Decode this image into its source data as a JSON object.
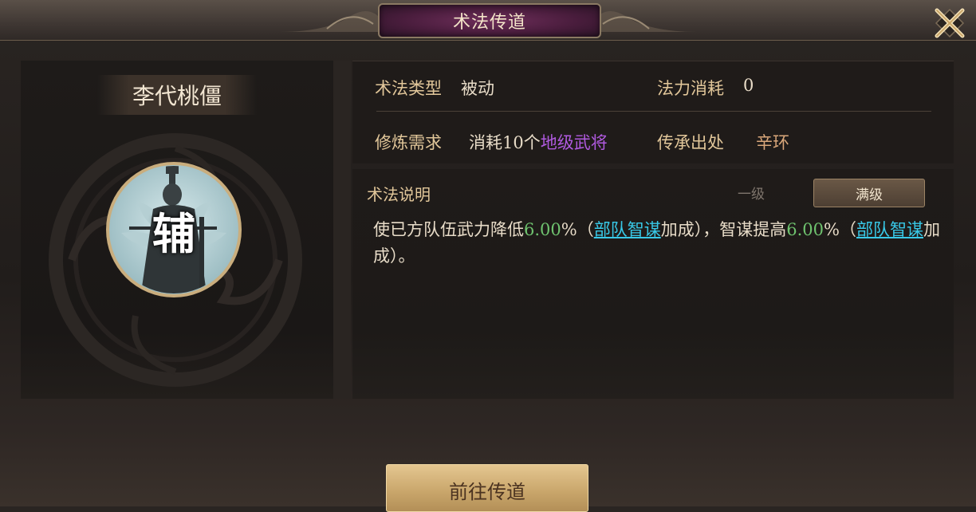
{
  "header": {
    "title": "术法传道"
  },
  "hero": {
    "name": "李代桃僵",
    "role_char": "辅"
  },
  "info": {
    "type_label": "术法类型",
    "type_value": "被动",
    "mana_label": "法力消耗",
    "mana_value": "0",
    "req_label": "修炼需求",
    "req_prefix": "消耗10个",
    "req_highlight": "地级武将",
    "origin_label": "传承出处",
    "origin_value": "辛环"
  },
  "description": {
    "heading": "术法说明",
    "tab_level1": "一级",
    "tab_max": "满级",
    "part1": "使已方队伍武力降低",
    "num1": "6.00",
    "part2": "%（",
    "link1": "部队智谋",
    "part3": "加成），智谋提高",
    "num2": "6.00",
    "part4": "%（",
    "link2": "部队智谋",
    "part5": "加成）。"
  },
  "actions": {
    "go_label": "前往传道"
  },
  "colors": {
    "gold_label": "#e2c79a",
    "number_green": "#6fc36f",
    "link_cyan": "#38c9e8",
    "rank_purple": "#b05adf",
    "origin_orange": "#d9a77a",
    "title_plate": "#4a1d3d"
  },
  "icons": {
    "close": "close-x-icon",
    "portrait": "advisor-portrait-icon",
    "emblem": "cloud-emblem-icon"
  }
}
